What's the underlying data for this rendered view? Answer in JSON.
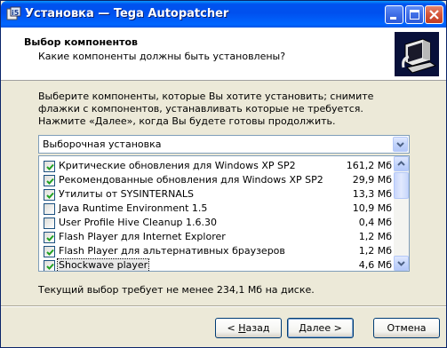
{
  "window": {
    "title": "Установка — Tega Autopatcher"
  },
  "header": {
    "title": "Выбор компонентов",
    "subtitle": "Какие компоненты должны быть установлены?"
  },
  "description": "Выберите компоненты, которые Вы хотите установить; снимите флажки с компонентов, устанавливать которые не требуется. Нажмите «Далее», когда Вы будете готовы продолжить.",
  "install_type": {
    "selected": "Выборочная установка"
  },
  "components": [
    {
      "label": "Критические обновления для Windows XP SP2",
      "size": "161,2 Мб",
      "checked": true
    },
    {
      "label": "Рекомендованные обновления для Windows XP SP2",
      "size": "29,9 Мб",
      "checked": true
    },
    {
      "label": "Утилиты от SYSINTERNALS",
      "size": "13,3 Мб",
      "checked": true
    },
    {
      "label": "Java Runtime Environment 1.5",
      "size": "10,9 Мб",
      "checked": false
    },
    {
      "label": "User Profile Hive Cleanup 1.6.30",
      "size": "0,4 Мб",
      "checked": false
    },
    {
      "label": "Flash Player для Internet Explorer",
      "size": "1,2 Мб",
      "checked": true
    },
    {
      "label": "Flash Player для альтернативных браузеров",
      "size": "1,2 Мб",
      "checked": true
    },
    {
      "label": "Shockwave player",
      "size": "4,6 Мб",
      "checked": true,
      "selected": true
    }
  ],
  "requirement": "Текущий выбор требует не менее 234,1 Мб на диске.",
  "buttons": {
    "back_underlined": "Н",
    "back_rest": "азад",
    "back_prefix": "< ",
    "next_underlined": "Д",
    "next_rest": "алее >",
    "cancel": "Отмена"
  },
  "icons": {
    "app": "installer-icon",
    "header": "computer-icon",
    "combo": "chevron-down-icon",
    "scroll_up": "arrow-up-icon",
    "scroll_down": "arrow-down-icon"
  },
  "colors": {
    "titlebar": "#0054E3",
    "window_bg": "#ECE9D8",
    "check": "#21A121"
  }
}
